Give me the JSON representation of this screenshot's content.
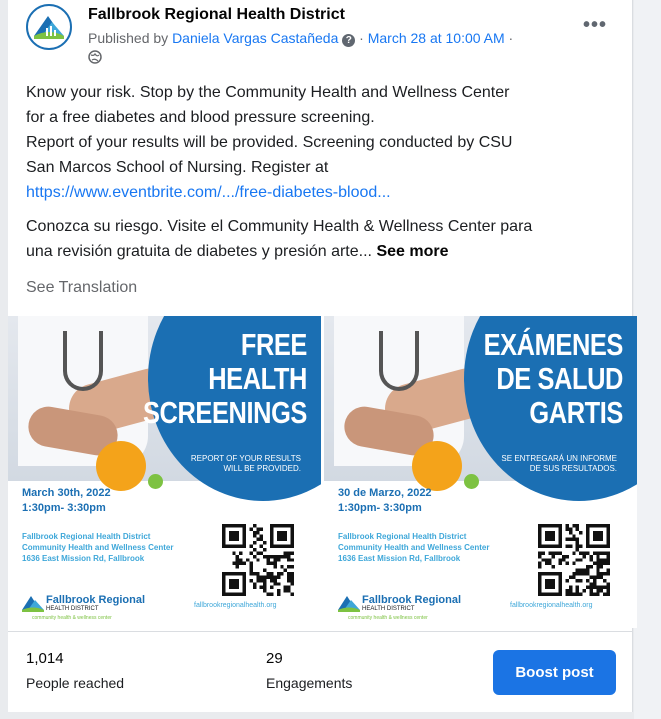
{
  "post": {
    "page_name": "Fallbrook Regional Health District",
    "published_by_prefix": "Published by ",
    "author": "Daniela Vargas Castañeda",
    "help_mark": "?",
    "separator": " · ",
    "date": "March 28 at 10:00 AM",
    "trailing_dot": " ·",
    "more_label": "•••",
    "text_lines": [
      "Know your risk. Stop by the Community Health and Wellness Center",
      "for a free diabetes and blood pressure screening.",
      "Report of your results will be provided. Screening conducted by CSU",
      "San Marcos School of Nursing.  Register at"
    ],
    "url": "https://www.eventbrite.com/.../free-diabetes-blood...",
    "spanish_lines": [
      "Conozca su riesgo. Visite el Community Health & Wellness Center para",
      "una revisión gratuita de diabetes y presión arte... "
    ],
    "see_more": "See more",
    "see_translation": "See Translation"
  },
  "flyers": {
    "english": {
      "headline": [
        "FREE",
        "HEALTH",
        "SCREENINGS"
      ],
      "report": [
        "REPORT OF YOUR RESULTS",
        "WILL BE PROVIDED."
      ],
      "date": "March 30th, 2022",
      "time": "1:30pm- 3:30pm",
      "address": [
        "Fallbrook Regional Health District",
        "Community Health and Wellness Center",
        "1636 East Mission Rd, Fallbrook"
      ],
      "logo_title": "Fallbrook Regional",
      "logo_sub": "HEALTH DISTRICT",
      "logo_tag": "community health & wellness center",
      "website": "fallbrookregionalhealth.org"
    },
    "spanish": {
      "headline": [
        "EXÁMENES",
        "DE SALUD",
        "GARTIS"
      ],
      "report": [
        "SE ENTREGARÁ UN INFORME",
        "DE SUS RESULTADOS."
      ],
      "date": "30 de Marzo, 2022",
      "time": "1:30pm- 3:30pm",
      "address": [
        "Fallbrook Regional Health District",
        "Community Health and Wellness Center",
        "1636 East Mission Rd, Fallbrook"
      ],
      "logo_title": "Fallbrook Regional",
      "logo_sub": "HEALTH DISTRICT",
      "logo_tag": "community health & wellness center",
      "website": "fallbrookregionalhealth.org"
    }
  },
  "stats": {
    "reach_value": "1,014",
    "reach_label": "People reached",
    "engagement_value": "29",
    "engagement_label": "Engagements"
  },
  "actions": {
    "boost_label": "Boost post"
  },
  "colors": {
    "brand_blue": "#1b6fb3",
    "facebook_blue": "#1877f2",
    "orange": "#f4a31a",
    "green": "#7dc242"
  }
}
